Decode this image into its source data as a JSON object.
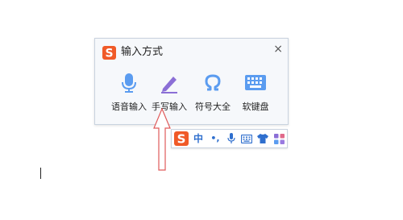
{
  "popup": {
    "title": "输入方式",
    "close_symbol": "×",
    "logo_letter": "S",
    "options": [
      {
        "label": "语音输入",
        "icon": "microphone-icon"
      },
      {
        "label": "手写输入",
        "icon": "pencil-icon"
      },
      {
        "label": "符号大全",
        "icon": "omega-icon"
      },
      {
        "label": "软键盘",
        "icon": "keyboard-icon"
      }
    ]
  },
  "toolbar": {
    "logo_letter": "S",
    "lang_label": "中",
    "punct_label": "•,",
    "items": [
      "voice-icon",
      "keyboard-icon",
      "skin-icon",
      "grid-icon"
    ]
  },
  "colors": {
    "accent_blue": "#2f6fce",
    "icon_light_blue": "#5b9cf0",
    "icon_purple": "#8b6fd6",
    "logo_orange": "#f05a28",
    "arrow_red": "#e05a5a"
  }
}
